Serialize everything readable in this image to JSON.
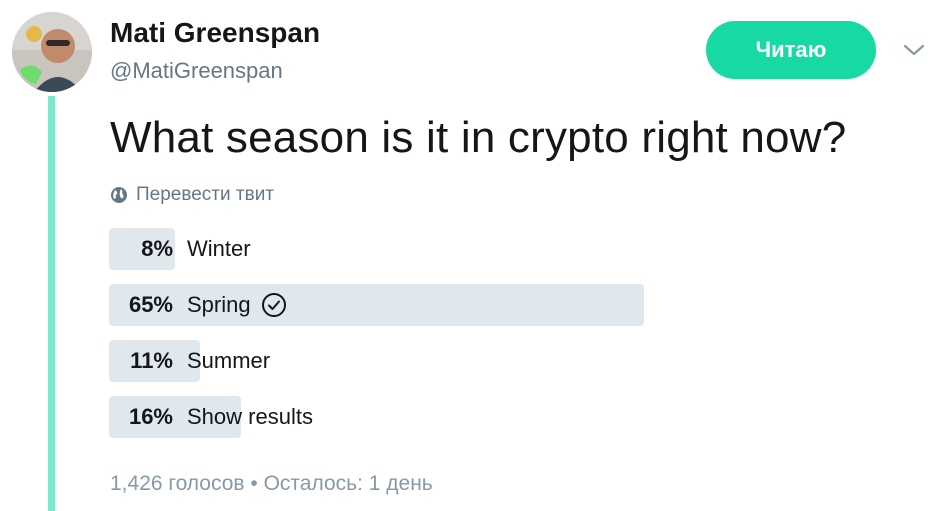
{
  "author": {
    "name": "Mati Greenspan",
    "handle": "@MatiGreenspan"
  },
  "follow_button": {
    "label": "Читаю"
  },
  "menu": {
    "icon": "chevron-down-icon"
  },
  "tweet": {
    "text": "What season is it in crypto right now?",
    "translate_label": "Перевести твит",
    "translate_icon": "globe-icon"
  },
  "poll": {
    "options": [
      {
        "percent_label": "8%",
        "percent": 8,
        "label": "Winter",
        "winner": false
      },
      {
        "percent_label": "65%",
        "percent": 65,
        "label": "Spring",
        "winner": true
      },
      {
        "percent_label": "11%",
        "percent": 11,
        "label": "Summer",
        "winner": false
      },
      {
        "percent_label": "16%",
        "percent": 16,
        "label": "Show results",
        "winner": false
      }
    ],
    "votes": "1,426 голосов",
    "separator": "•",
    "time_left": "Осталось: 1 день"
  },
  "colors": {
    "accent": "#17d9a3",
    "thread_line": "#7ee8cf",
    "poll_fill": "#e1e8ed",
    "secondary_text": "#657786"
  }
}
